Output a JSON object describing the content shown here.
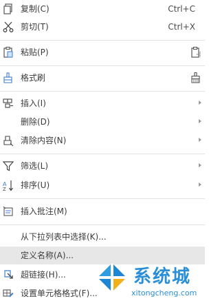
{
  "menu": {
    "copy": {
      "label": "复制(C)",
      "shortcut": "Ctrl+C",
      "icon": "copy-icon"
    },
    "cut": {
      "label": "剪切(T)",
      "shortcut": "Ctrl+X",
      "icon": "scissors-icon"
    },
    "paste": {
      "label": "粘贴(P)",
      "icon": "clipboard-icon"
    },
    "format_painter": {
      "label": "格式刷",
      "icon": "format-brush-icon"
    },
    "insert": {
      "label": "插入(I)",
      "icon": "insert-cells-icon"
    },
    "delete": {
      "label": "删除(D)"
    },
    "clear": {
      "label": "清除内容(N)",
      "icon": "eraser-icon"
    },
    "filter": {
      "label": "筛选(L)",
      "icon": "funnel-icon"
    },
    "sort": {
      "label": "排序(U)",
      "icon": "sort-icon"
    },
    "insert_comment": {
      "label": "插入批注(M)",
      "icon": "comment-icon"
    },
    "pick_from_list": {
      "label": "从下拉列表中选择(K)..."
    },
    "define_name": {
      "label": "定义名称(A)..."
    },
    "hyperlink": {
      "label": "超链接(H)...",
      "icon": "link-icon"
    },
    "format_cells": {
      "label": "设置单元格格式(F)...",
      "icon": "format-cells-icon"
    }
  },
  "watermark": {
    "title": "系统城",
    "subtitle": "xitongcheng.com"
  },
  "colors": {
    "highlight": "#e7e7e7",
    "separator": "#e3e3e3",
    "text": "#3c3c3c",
    "icon_blue": "#3f7fd0",
    "watermark_blue": "#2a8fd6"
  }
}
